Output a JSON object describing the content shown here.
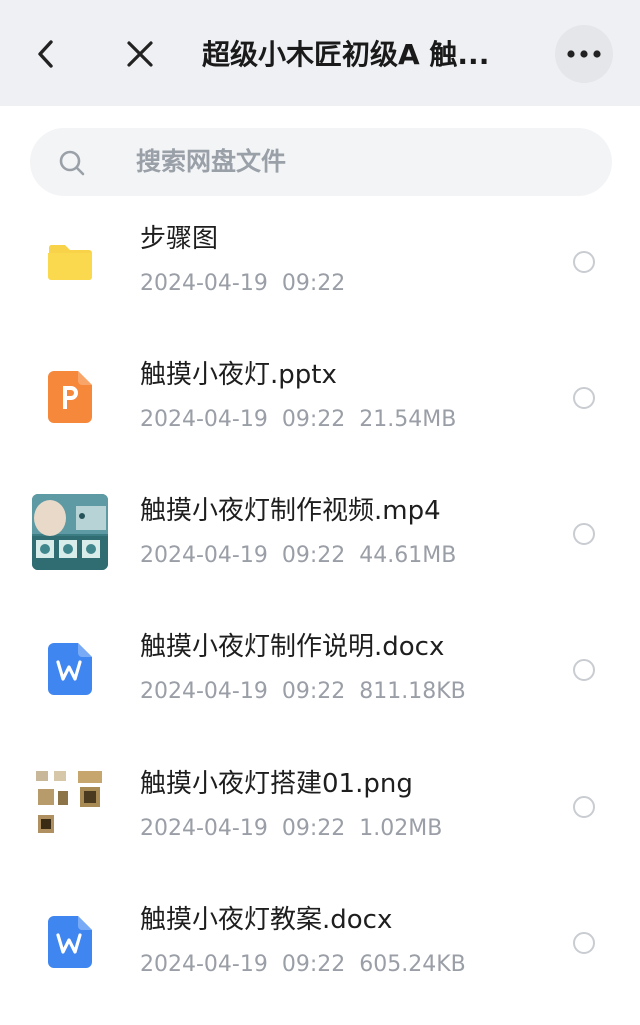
{
  "header": {
    "title": "超级小木匠初级A 触...",
    "back_icon": "chevron-left-icon",
    "close_icon": "close-icon",
    "more_icon": "more-icon"
  },
  "search": {
    "placeholder": "搜索网盘文件",
    "icon": "search-icon"
  },
  "files": [
    {
      "name": "步骤图",
      "date": "2024-04-19",
      "time": "09:22",
      "size": "",
      "type": "folder-icon"
    },
    {
      "name": "触摸小夜灯.pptx",
      "date": "2024-04-19",
      "time": "09:22",
      "size": "21.54MB",
      "type": "ppt-icon"
    },
    {
      "name": "触摸小夜灯制作视频.mp4",
      "date": "2024-04-19",
      "time": "09:22",
      "size": "44.61MB",
      "type": "video-thumbnail"
    },
    {
      "name": "触摸小夜灯制作说明.docx",
      "date": "2024-04-19",
      "time": "09:22",
      "size": "811.18KB",
      "type": "word-icon"
    },
    {
      "name": "触摸小夜灯搭建01.png",
      "date": "2024-04-19",
      "time": "09:22",
      "size": "1.02MB",
      "type": "image-thumbnail"
    },
    {
      "name": "触摸小夜灯教案.docx",
      "date": "2024-04-19",
      "time": "09:22",
      "size": "605.24KB",
      "type": "word-icon"
    }
  ],
  "colors": {
    "folder": "#f8d34a",
    "ppt": "#f5883b",
    "word": "#3f86f0",
    "topbar_bg": "#eef0f3"
  }
}
